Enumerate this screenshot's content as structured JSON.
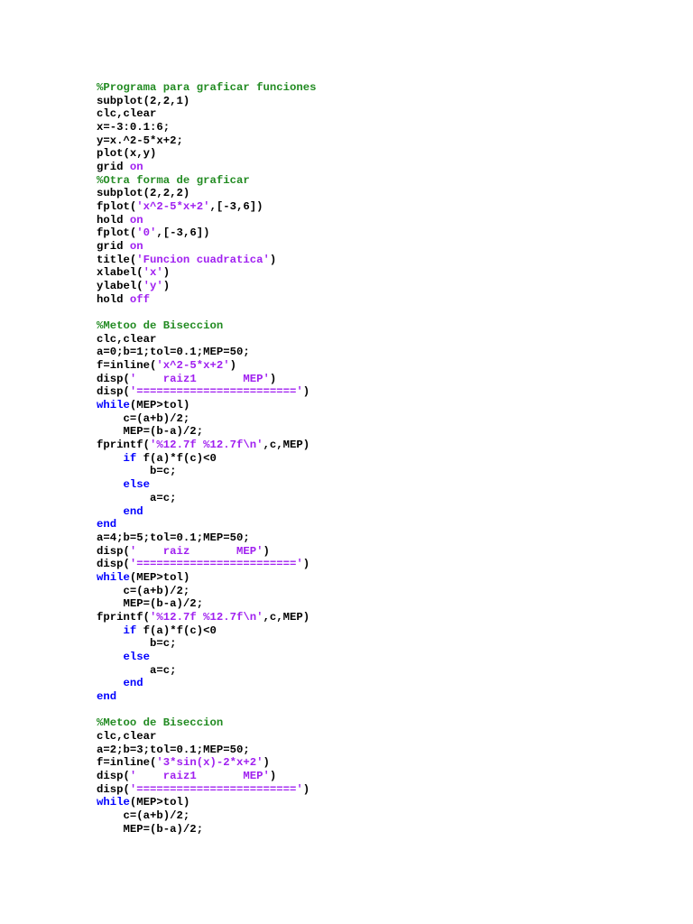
{
  "colors": {
    "keyword": "#0000ff",
    "string": "#a020f0",
    "comment": "#228b22",
    "text": "#000000"
  },
  "lines": [
    [
      {
        "t": "%Programa para graficar funciones",
        "k": "c"
      }
    ],
    [
      {
        "t": "subplot(2,2,1)",
        "k": "n"
      }
    ],
    [
      {
        "t": "clc,clear",
        "k": "n"
      }
    ],
    [
      {
        "t": "x=-3:0.1:6;",
        "k": "n"
      }
    ],
    [
      {
        "t": "y=x.^2-5*x+2;",
        "k": "n"
      }
    ],
    [
      {
        "t": "plot(x,y)",
        "k": "n"
      }
    ],
    [
      {
        "t": "grid ",
        "k": "n"
      },
      {
        "t": "on",
        "k": "s"
      }
    ],
    [
      {
        "t": "%Otra forma de graficar",
        "k": "c"
      }
    ],
    [
      {
        "t": "subplot(2,2,2)",
        "k": "n"
      }
    ],
    [
      {
        "t": "fplot(",
        "k": "n"
      },
      {
        "t": "'x^2-5*x+2'",
        "k": "s"
      },
      {
        "t": ",[-3,6])",
        "k": "n"
      }
    ],
    [
      {
        "t": "hold ",
        "k": "n"
      },
      {
        "t": "on",
        "k": "s"
      }
    ],
    [
      {
        "t": "fplot(",
        "k": "n"
      },
      {
        "t": "'0'",
        "k": "s"
      },
      {
        "t": ",[-3,6])",
        "k": "n"
      }
    ],
    [
      {
        "t": "grid ",
        "k": "n"
      },
      {
        "t": "on",
        "k": "s"
      }
    ],
    [
      {
        "t": "title(",
        "k": "n"
      },
      {
        "t": "'Funcion cuadratica'",
        "k": "s"
      },
      {
        "t": ")",
        "k": "n"
      }
    ],
    [
      {
        "t": "xlabel(",
        "k": "n"
      },
      {
        "t": "'x'",
        "k": "s"
      },
      {
        "t": ")",
        "k": "n"
      }
    ],
    [
      {
        "t": "ylabel(",
        "k": "n"
      },
      {
        "t": "'y'",
        "k": "s"
      },
      {
        "t": ")",
        "k": "n"
      }
    ],
    [
      {
        "t": "hold ",
        "k": "n"
      },
      {
        "t": "off",
        "k": "s"
      }
    ],
    [],
    [
      {
        "t": "%Metoo de Biseccion",
        "k": "c"
      }
    ],
    [
      {
        "t": "clc,clear",
        "k": "n"
      }
    ],
    [
      {
        "t": "a=0;b=1;tol=0.1;MEP=50;",
        "k": "n"
      }
    ],
    [
      {
        "t": "f=inline(",
        "k": "n"
      },
      {
        "t": "'x^2-5*x+2'",
        "k": "s"
      },
      {
        "t": ")",
        "k": "n"
      }
    ],
    [
      {
        "t": "disp(",
        "k": "n"
      },
      {
        "t": "'    raiz1       MEP'",
        "k": "s"
      },
      {
        "t": ")",
        "k": "n"
      }
    ],
    [
      {
        "t": "disp(",
        "k": "n"
      },
      {
        "t": "'========================'",
        "k": "s"
      },
      {
        "t": ")",
        "k": "n"
      }
    ],
    [
      {
        "t": "while",
        "k": "k"
      },
      {
        "t": "(MEP>tol)",
        "k": "n"
      }
    ],
    [
      {
        "t": "    c=(a+b)/2;",
        "k": "n"
      }
    ],
    [
      {
        "t": "    MEP=(b-a)/2;",
        "k": "n"
      }
    ],
    [
      {
        "t": "fprintf(",
        "k": "n"
      },
      {
        "t": "'%12.7f %12.7f\\n'",
        "k": "s"
      },
      {
        "t": ",c,MEP)",
        "k": "n"
      }
    ],
    [
      {
        "t": "    ",
        "k": "n"
      },
      {
        "t": "if",
        "k": "k"
      },
      {
        "t": " f(a)*f(c)<0",
        "k": "n"
      }
    ],
    [
      {
        "t": "        b=c;",
        "k": "n"
      }
    ],
    [
      {
        "t": "    ",
        "k": "n"
      },
      {
        "t": "else",
        "k": "k"
      }
    ],
    [
      {
        "t": "        a=c;",
        "k": "n"
      }
    ],
    [
      {
        "t": "    ",
        "k": "n"
      },
      {
        "t": "end",
        "k": "k"
      }
    ],
    [
      {
        "t": "end",
        "k": "k"
      }
    ],
    [
      {
        "t": "a=4;b=5;tol=0.1;MEP=50;",
        "k": "n"
      }
    ],
    [
      {
        "t": "disp(",
        "k": "n"
      },
      {
        "t": "'    raiz       MEP'",
        "k": "s"
      },
      {
        "t": ")",
        "k": "n"
      }
    ],
    [
      {
        "t": "disp(",
        "k": "n"
      },
      {
        "t": "'========================'",
        "k": "s"
      },
      {
        "t": ")",
        "k": "n"
      }
    ],
    [
      {
        "t": "while",
        "k": "k"
      },
      {
        "t": "(MEP>tol)",
        "k": "n"
      }
    ],
    [
      {
        "t": "    c=(a+b)/2;",
        "k": "n"
      }
    ],
    [
      {
        "t": "    MEP=(b-a)/2;",
        "k": "n"
      }
    ],
    [
      {
        "t": "fprintf(",
        "k": "n"
      },
      {
        "t": "'%12.7f %12.7f\\n'",
        "k": "s"
      },
      {
        "t": ",c,MEP)",
        "k": "n"
      }
    ],
    [
      {
        "t": "    ",
        "k": "n"
      },
      {
        "t": "if",
        "k": "k"
      },
      {
        "t": " f(a)*f(c)<0",
        "k": "n"
      }
    ],
    [
      {
        "t": "        b=c;",
        "k": "n"
      }
    ],
    [
      {
        "t": "    ",
        "k": "n"
      },
      {
        "t": "else",
        "k": "k"
      }
    ],
    [
      {
        "t": "        a=c;",
        "k": "n"
      }
    ],
    [
      {
        "t": "    ",
        "k": "n"
      },
      {
        "t": "end",
        "k": "k"
      }
    ],
    [
      {
        "t": "end",
        "k": "k"
      }
    ],
    [],
    [
      {
        "t": "%Metoo de Biseccion",
        "k": "c"
      }
    ],
    [
      {
        "t": "clc,clear",
        "k": "n"
      }
    ],
    [
      {
        "t": "a=2;b=3;tol=0.1;MEP=50;",
        "k": "n"
      }
    ],
    [
      {
        "t": "f=inline(",
        "k": "n"
      },
      {
        "t": "'3*sin(x)-2*x+2'",
        "k": "s"
      },
      {
        "t": ")",
        "k": "n"
      }
    ],
    [
      {
        "t": "disp(",
        "k": "n"
      },
      {
        "t": "'    raiz1       MEP'",
        "k": "s"
      },
      {
        "t": ")",
        "k": "n"
      }
    ],
    [
      {
        "t": "disp(",
        "k": "n"
      },
      {
        "t": "'========================'",
        "k": "s"
      },
      {
        "t": ")",
        "k": "n"
      }
    ],
    [
      {
        "t": "while",
        "k": "k"
      },
      {
        "t": "(MEP>tol)",
        "k": "n"
      }
    ],
    [
      {
        "t": "    c=(a+b)/2;",
        "k": "n"
      }
    ],
    [
      {
        "t": "    MEP=(b-a)/2;",
        "k": "n"
      }
    ]
  ]
}
